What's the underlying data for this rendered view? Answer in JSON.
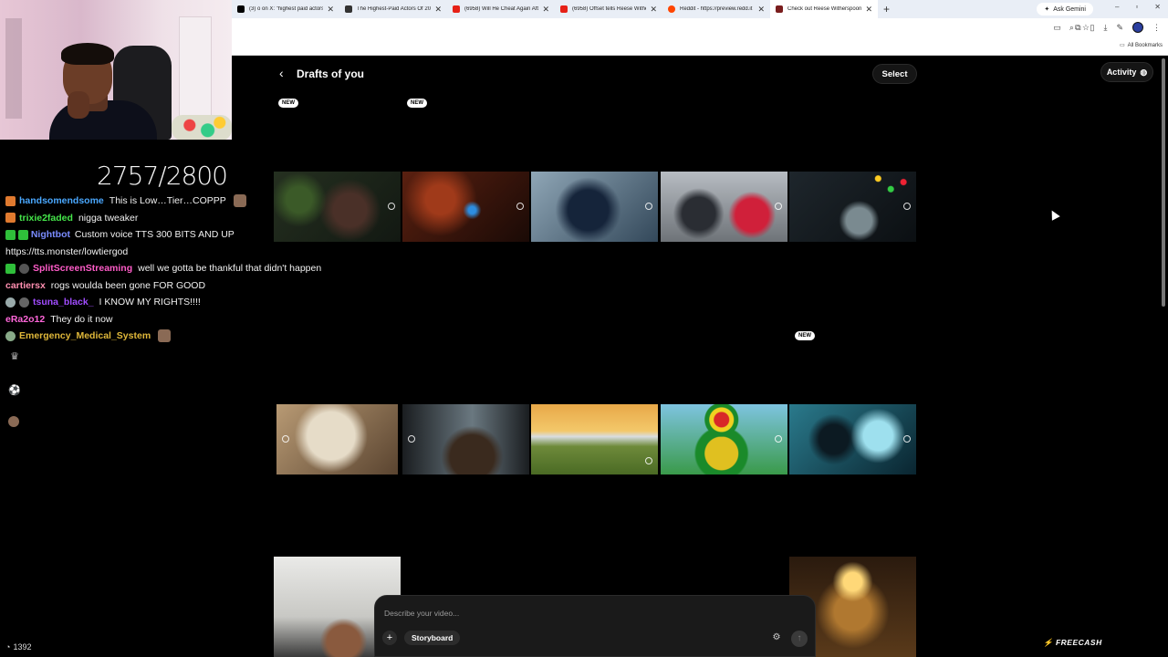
{
  "browser": {
    "tabs": [
      {
        "title": "(3) o on X: \"highest paid actors",
        "color": "#000000"
      },
      {
        "title": "The Highest-Paid Actors Of 20...",
        "color": "#333333"
      },
      {
        "title": "(6958) Will He Cheat Again Aft...",
        "color": "#e62117"
      },
      {
        "title": "(6958) Offset tells Reese Withe...",
        "color": "#e62117"
      },
      {
        "title": "Reddit - https://preview.redd.it",
        "color": "#ff4500"
      },
      {
        "title": "Check out Reese Witherspoon",
        "color": "#7a1d1d"
      }
    ],
    "ask_gemini": "Ask Gemini",
    "all_bookmarks": "All Bookmarks"
  },
  "stream": {
    "counter": "2757/2800",
    "viewers": "1392",
    "chat": [
      {
        "user": "handsomendsome",
        "color": "#4aa8ff",
        "text": "This is Low…Tier…COPPP",
        "badge": "#e07a2f"
      },
      {
        "user": "trixie2faded",
        "color": "#45e64a",
        "text": "nigga tweaker",
        "badge": "#e07a2f"
      },
      {
        "user": "Nightbot",
        "color": "#7a8cff",
        "text": "Custom voice TTS 300 BITS AND UP https://tts.monster/lowtiergod",
        "badge": "#2fbf3a"
      },
      {
        "user": "SplitScreenStreaming",
        "color": "#ff5cc8",
        "text": "well we gotta be thankful that didn't happen",
        "badge": "#2fbf3a"
      },
      {
        "user": "cartiersx",
        "color": "#ff8fb0",
        "text": "rogs woulda been gone FOR GOOD",
        "badge": ""
      },
      {
        "user": "tsuna_black_",
        "color": "#a14cff",
        "text": "I KNOW MY RIGHTS!!!!",
        "badge": "#9aa"
      },
      {
        "user": "eRa2o12",
        "color": "#ff66d9",
        "text": "They do it now",
        "badge": ""
      },
      {
        "user": "Emergency_Medical_System",
        "color": "#e0b83a",
        "text": "",
        "badge": "#8a8"
      }
    ]
  },
  "page": {
    "title": "Drafts of you",
    "select_label": "Select",
    "activity_label": "Activity",
    "new_badge": "NEW",
    "prompt": {
      "placeholder": "Describe your video...",
      "storyboard_label": "Storyboard"
    },
    "brand": "FREECASH",
    "scroll_position": 0.0
  },
  "colors": {
    "thumbs_row1": [
      "#1c2418",
      "#3a1a10",
      "#1b2a3a",
      "#8a8e95",
      "#182026"
    ],
    "thumbs_row2": [
      "#c9b79c",
      "#2b3036",
      "#c89548",
      "#49a2c8",
      "#1b4b5a"
    ],
    "thumbs_row3": [
      "#d8d8d6",
      "#3b2a18"
    ]
  }
}
